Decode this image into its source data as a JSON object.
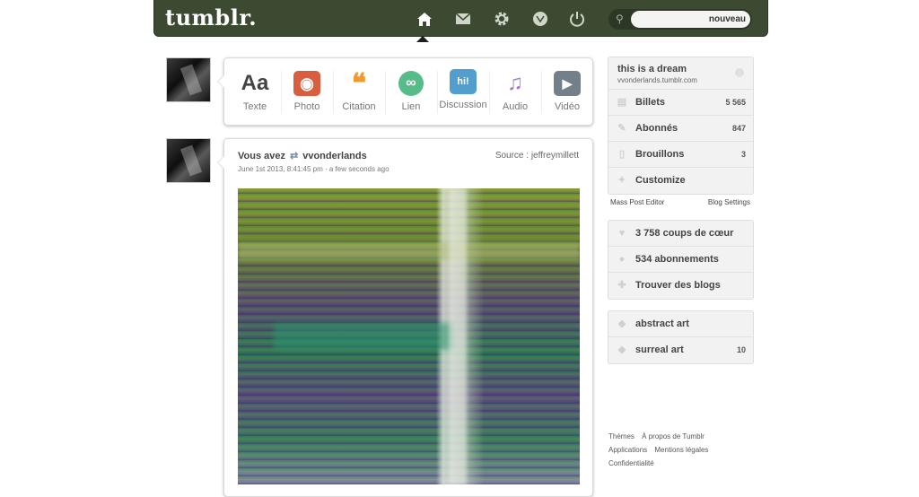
{
  "app": {
    "logo": "tumblr.",
    "search_value": "nouveau"
  },
  "nav": {
    "icons": [
      "home-icon",
      "mail-icon",
      "gear-icon",
      "explore-icon",
      "power-icon"
    ]
  },
  "composer": {
    "types": [
      {
        "label": "Texte",
        "glyph": "Aa",
        "color": "#444444"
      },
      {
        "label": "Photo",
        "glyph": "◉",
        "color": "#d95e40"
      },
      {
        "label": "Citation",
        "glyph": "❝",
        "color": "#f2992e"
      },
      {
        "label": "Lien",
        "glyph": "∞",
        "color": "#56bc8a"
      },
      {
        "label": "Discussion",
        "glyph": "hi!",
        "color": "#529ecc"
      },
      {
        "label": "Audio",
        "glyph": "♫",
        "color": "#a77dc2"
      },
      {
        "label": "Vidéo",
        "glyph": "▶",
        "color": "#748089"
      }
    ]
  },
  "post": {
    "you": "Vous avez",
    "reblogged_from": "vvonderlands",
    "date": "June 1st 2013, 8:41:45 pm",
    "relative": "a few seconds ago",
    "source": "Source : jeffreymillett"
  },
  "blog": {
    "title": "this is a dream",
    "url": "vvonderlands.tumblr.com",
    "rows": [
      {
        "label": "Billets",
        "count": "5 565"
      },
      {
        "label": "Abonnés",
        "count": "847"
      },
      {
        "label": "Brouillons",
        "count": "3"
      },
      {
        "label": "Customize",
        "count": ""
      }
    ],
    "mass_post_editor": "Mass Post Editor",
    "blog_settings": "Blog Settings"
  },
  "activity": {
    "rows": [
      {
        "label": "3 758 coups de cœur"
      },
      {
        "label": "534 abonnements"
      },
      {
        "label": "Trouver des blogs"
      }
    ]
  },
  "tags": {
    "rows": [
      {
        "label": "abstract art",
        "count": ""
      },
      {
        "label": "surreal art",
        "count": "10"
      }
    ]
  },
  "footer": {
    "themes": "Thèmes",
    "about": "À propos de Tumblr",
    "apps": "Applications",
    "legal": "Mentions légales",
    "privacy": "Confidentialité"
  }
}
